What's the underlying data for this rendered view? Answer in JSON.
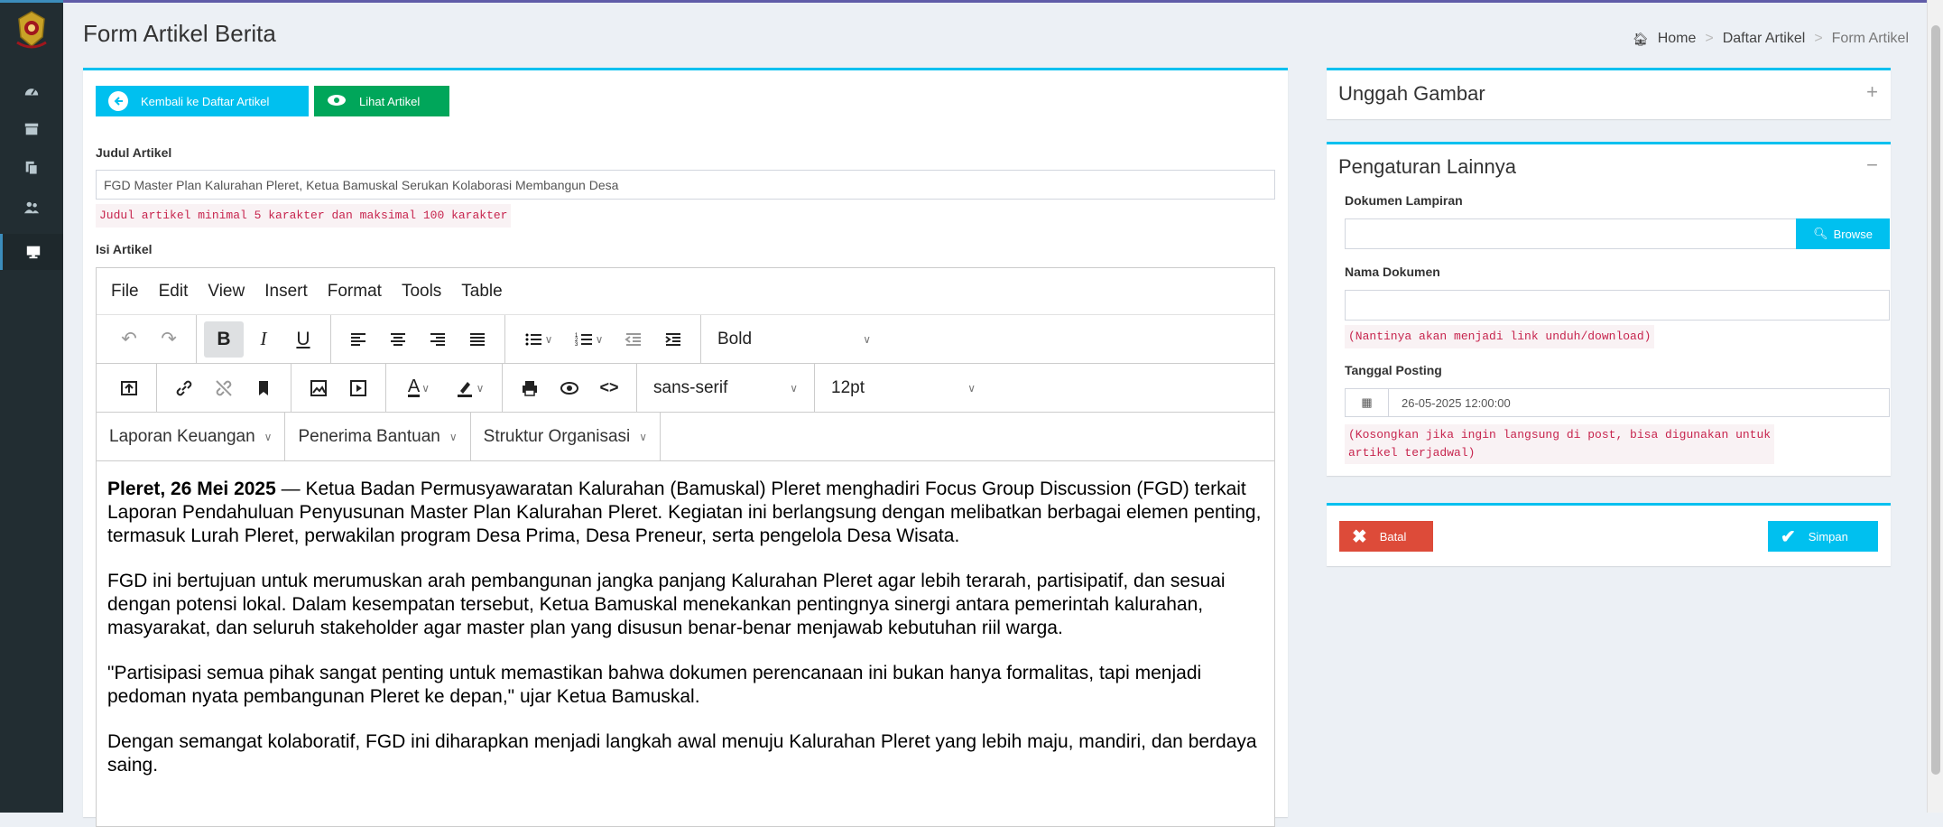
{
  "page_title": "Form Artikel Berita",
  "breadcrumb": {
    "home": "Home",
    "list": "Daftar Artikel",
    "current": "Form Artikel"
  },
  "buttons": {
    "back": "Kembali ke Daftar Artikel",
    "view": "Lihat Artikel"
  },
  "judul": {
    "label": "Judul Artikel",
    "value": "FGD Master Plan Kalurahan Pleret, Ketua Bamuskal Serukan Kolaborasi Membangun Desa",
    "hint": "Judul artikel minimal 5 karakter dan maksimal 100 karakter"
  },
  "isi": {
    "label": "Isi Artikel"
  },
  "editor": {
    "menu": [
      "File",
      "Edit",
      "View",
      "Insert",
      "Format",
      "Tools",
      "Table"
    ],
    "format_value": "Bold",
    "font_value": "sans-serif",
    "size_value": "12pt",
    "custom_menus": [
      "Laporan Keuangan",
      "Penerima Bantuan",
      "Struktur Organisasi"
    ],
    "paragraphs": [
      {
        "bold": "Pleret, 26 Mei 2025",
        "text": " — Ketua Badan Permusyawaratan Kalurahan (Bamuskal) Pleret menghadiri Focus Group Discussion (FGD) terkait Laporan Pendahuluan Penyusunan Master Plan Kalurahan Pleret. Kegiatan ini berlangsung dengan melibatkan berbagai elemen penting, termasuk Lurah Pleret, perwakilan program Desa Prima, Desa Preneur, serta pengelola Desa Wisata."
      },
      {
        "bold": "",
        "text": "FGD ini bertujuan untuk merumuskan arah pembangunan jangka panjang Kalurahan Pleret agar lebih terarah, partisipatif, dan sesuai dengan potensi lokal. Dalam kesempatan tersebut, Ketua Bamuskal menekankan pentingnya sinergi antara pemerintah kalurahan, masyarakat, dan seluruh stakeholder agar master plan yang disusun benar-benar menjawab kebutuhan riil warga."
      },
      {
        "bold": "",
        "text": "\"Partisipasi semua pihak sangat penting untuk memastikan bahwa dokumen perencanaan ini bukan hanya formalitas, tapi menjadi pedoman nyata pembangunan Pleret ke depan,\" ujar Ketua Bamuskal."
      },
      {
        "bold": "",
        "text": "Dengan semangat kolaboratif, FGD ini diharapkan menjadi langkah awal menuju Kalurahan Pleret yang lebih maju, mandiri, dan berdaya saing."
      }
    ]
  },
  "upload": {
    "title": "Unggah Gambar",
    "tool": "+"
  },
  "settings": {
    "title": "Pengaturan Lainnya",
    "tool": "−",
    "doc_label": "Dokumen Lampiran",
    "browse": "Browse",
    "name_label": "Nama Dokumen",
    "name_hint": "(Nantinya akan menjadi link unduh/download)",
    "date_label": "Tanggal Posting",
    "date_value": "26-05-2025 12:00:00",
    "date_hint_1": "(Kosongkan jika ingin langsung di post, bisa digunakan untuk",
    "date_hint_2": "artikel terjadwal)"
  },
  "actions": {
    "cancel": "Batal",
    "save": "Simpan"
  },
  "colors": {
    "info": "#00c0ef",
    "success": "#00a65a",
    "danger": "#dd4b39",
    "sidebar": "#222d32"
  }
}
